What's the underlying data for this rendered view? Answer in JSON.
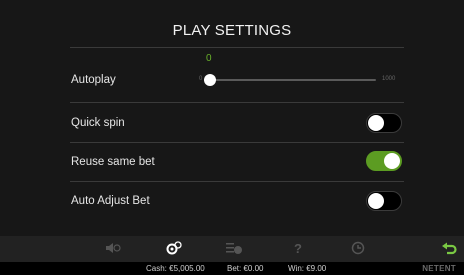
{
  "title": "PLAY SETTINGS",
  "autoplay": {
    "label": "Autoplay",
    "value": "0",
    "min_label": "0",
    "max_label": "1000",
    "fraction": 0.0
  },
  "settings": [
    {
      "label": "Quick spin",
      "on": false
    },
    {
      "label": "Reuse same bet",
      "on": true
    },
    {
      "label": "Auto Adjust Bet",
      "on": false
    }
  ],
  "toolbar": {
    "icons": [
      "sound-off-icon",
      "settings-icon",
      "bet-coins-icon",
      "help-icon",
      "history-icon",
      "back-arrow-icon"
    ]
  },
  "footer": {
    "cash": "Cash: €5,005.00",
    "bet": "Bet: €0.00",
    "win": "Win: €9.00",
    "brand": "NETENT"
  },
  "colors": {
    "accent_green": "#5c9c22",
    "value_green": "#68b02a",
    "panel": "#171717"
  }
}
